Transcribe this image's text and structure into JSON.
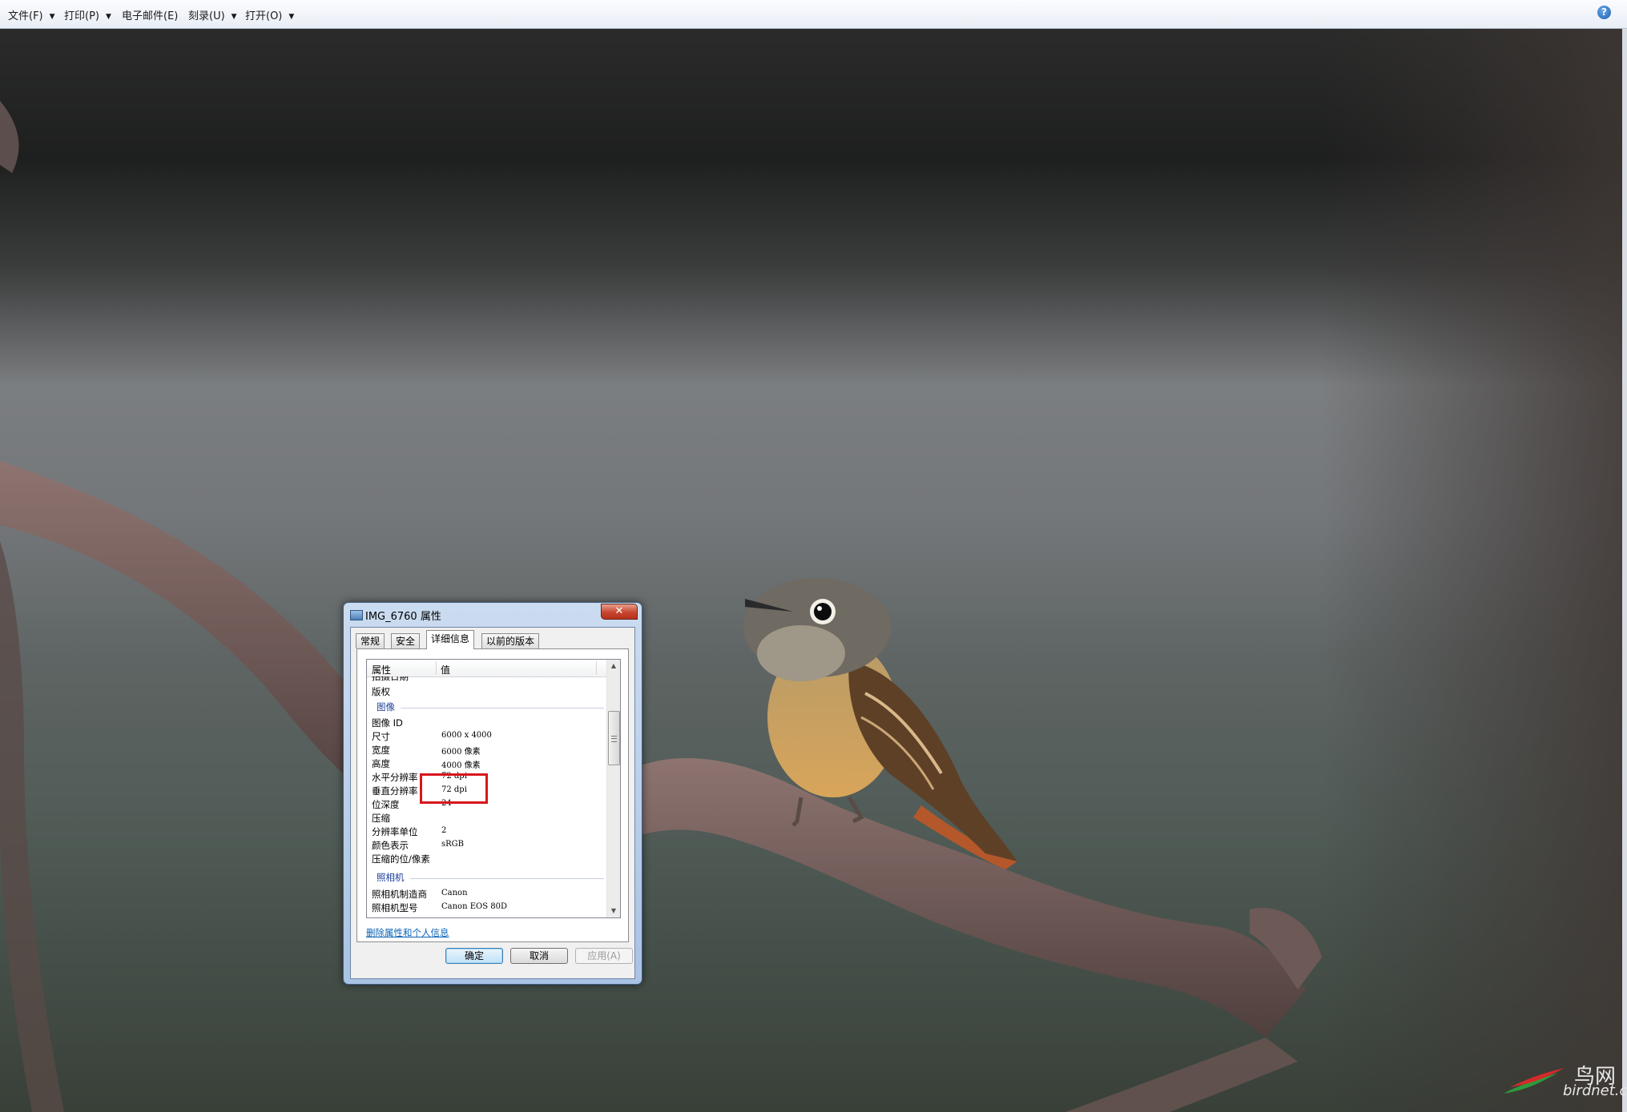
{
  "menu": {
    "items": [
      {
        "label": "文件(F)"
      },
      {
        "label": "打印(P)"
      },
      {
        "label": "电子邮件(E)"
      },
      {
        "label": "刻录(U)"
      },
      {
        "label": "打开(O)"
      }
    ],
    "help_icon": "?"
  },
  "dialog": {
    "title": "IMG_6760 属性",
    "close_glyph": "✕",
    "tabs": [
      {
        "label": "常规"
      },
      {
        "label": "安全"
      },
      {
        "label": "详细信息"
      },
      {
        "label": "以前的版本"
      }
    ],
    "active_tab": "详细信息",
    "columns": {
      "property": "属性",
      "value": "值"
    },
    "clipped_row": "拍摄日期",
    "rows_top": [
      {
        "key": "版权",
        "value": ""
      }
    ],
    "group_image": "图像",
    "image_rows": [
      {
        "key": "图像 ID",
        "value": ""
      },
      {
        "key": "尺寸",
        "value": "6000 x 4000"
      },
      {
        "key": "宽度",
        "value": "6000 像素"
      },
      {
        "key": "高度",
        "value": "4000 像素"
      },
      {
        "key": "水平分辨率",
        "value": "72 dpi"
      },
      {
        "key": "垂直分辨率",
        "value": "72 dpi"
      },
      {
        "key": "位深度",
        "value": "24"
      },
      {
        "key": "压缩",
        "value": ""
      },
      {
        "key": "分辨率单位",
        "value": "2"
      },
      {
        "key": "颜色表示",
        "value": "sRGB"
      },
      {
        "key": "压缩的位/像素",
        "value": ""
      }
    ],
    "group_camera": "照相机",
    "camera_rows": [
      {
        "key": "照相机制造商",
        "value": "Canon"
      },
      {
        "key": "照相机型号",
        "value": "Canon EOS 80D"
      }
    ],
    "remove_link": "删除属性和个人信息",
    "buttons": {
      "ok": "确定",
      "cancel": "取消",
      "apply": "应用(A)"
    }
  },
  "watermark": {
    "name": "鸟网",
    "domain": "birdnet.cn"
  },
  "colors": {
    "highlight": "#d8161b",
    "group_text": "#1e3f9c",
    "link": "#0a63b8"
  }
}
